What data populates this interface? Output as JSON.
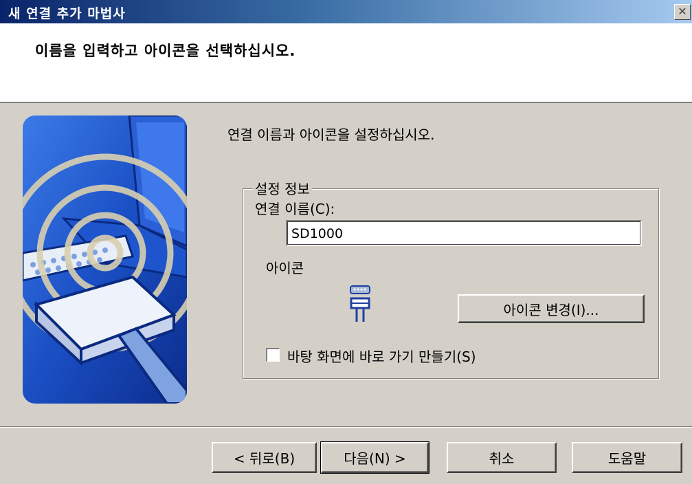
{
  "window": {
    "title": "새 연결 추가 마법사",
    "close_glyph": "✕"
  },
  "header": {
    "title": "이름을 입력하고 아이콘을 선택하십시오."
  },
  "content": {
    "instruction": "연결 이름과 아이콘을 설정하십시오.",
    "group_title": "설정 정보",
    "name_label": "연결 이름(C):",
    "name_value": "SD1000",
    "icon_label": "아이콘",
    "change_icon_button": "아이콘 변경(I)...",
    "shortcut_checkbox_label": "바탕 화면에 바로 가기 만들기(S)",
    "shortcut_checked": false,
    "connection_icon": "serial-connector-icon"
  },
  "buttons": {
    "back": "< 뒤로(B)",
    "next": "다음(N) >",
    "cancel": "취소",
    "help": "도움말"
  },
  "colors": {
    "titlebar_start": "#0a246a",
    "titlebar_end": "#a6caf0",
    "dialog_bg": "#d4d0c8",
    "art_blue": "#1e4fbf"
  }
}
